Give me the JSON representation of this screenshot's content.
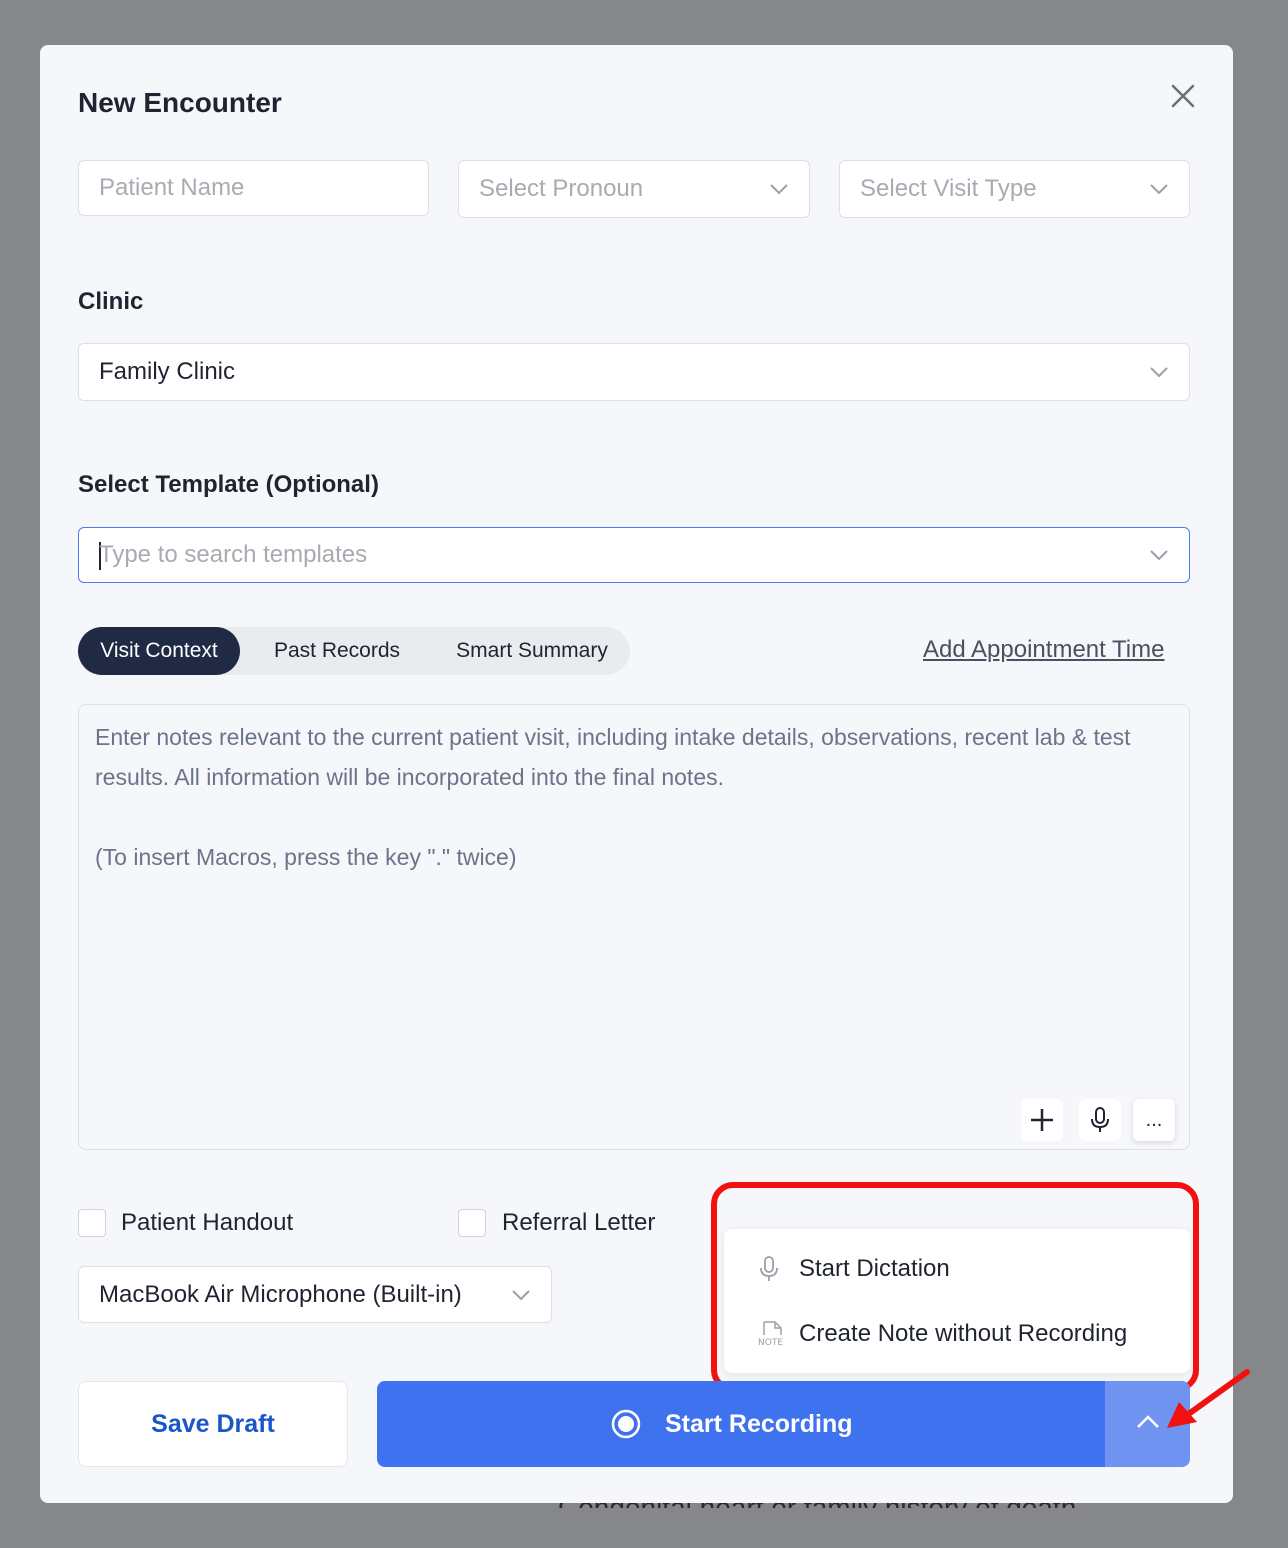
{
  "modal": {
    "title": "New Encounter"
  },
  "fields": {
    "patient_name_placeholder": "Patient Name",
    "pronoun_placeholder": "Select Pronoun",
    "visit_type_placeholder": "Select Visit Type"
  },
  "clinic": {
    "label": "Clinic",
    "value": "Family Clinic"
  },
  "template": {
    "label": "Select Template (Optional)",
    "placeholder": "Type to search templates"
  },
  "tabs": [
    {
      "label": "Visit Context",
      "active": true
    },
    {
      "label": "Past Records",
      "active": false
    },
    {
      "label": "Smart Summary",
      "active": false
    }
  ],
  "add_appointment_link": "Add Appointment Time",
  "notes": {
    "placeholder_line1": "Enter notes relevant to the current patient visit, including intake details, observations, recent lab & test results. All information will be incorporated into the final notes.",
    "placeholder_line2": "(To insert Macros, press the key \".\" twice)"
  },
  "toolbar": {
    "more_label": "..."
  },
  "checkboxes": {
    "patient_handout": "Patient Handout",
    "referral_letter": "Referral Letter"
  },
  "microphone": {
    "value": "MacBook Air Microphone (Built-in)"
  },
  "dropdown_menu": {
    "start_dictation": "Start Dictation",
    "create_note": "Create Note without Recording",
    "note_icon_text": "NOTE"
  },
  "buttons": {
    "save_draft": "Save Draft",
    "start_recording": "Start Recording"
  },
  "background_text": "Congenital heart or family history of death",
  "colors": {
    "primary": "#3f72ef",
    "primary_toggle": "#6f93f0",
    "tab_active": "#202a44",
    "annotation": "#f21010",
    "link_blue": "#1a56c8"
  }
}
